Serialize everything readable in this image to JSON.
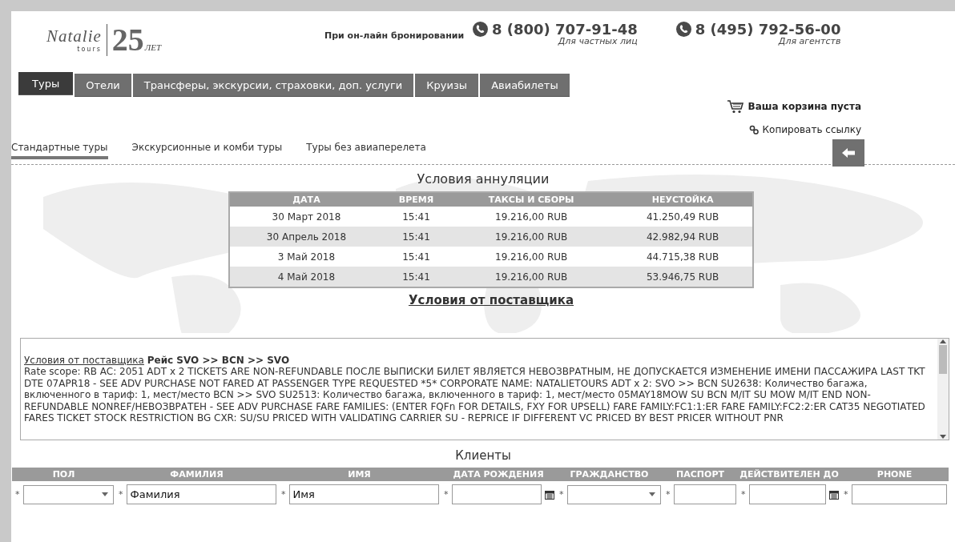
{
  "header": {
    "logo_year": "25",
    "logo_years_word": "ЛЕТ",
    "logo_brand": "Natalie",
    "logo_sub": "tours",
    "booking_label": "При он-лайн бронировании",
    "phones": [
      {
        "number": "8 (800) 707-91-48",
        "note": "Для частных лиц"
      },
      {
        "number": "8 (495) 792-56-00",
        "note": "Для агентств"
      }
    ]
  },
  "nav": [
    {
      "label": "Туры",
      "selected": true
    },
    {
      "label": "Отели",
      "selected": false
    },
    {
      "label": "Трансферы, экскурсии, страховки, доп. услуги",
      "selected": false
    },
    {
      "label": "Круизы",
      "selected": false
    },
    {
      "label": "Авиабилеты",
      "selected": false
    }
  ],
  "cart": "Ваша корзина пуста",
  "copy_link": "Копировать ссылку",
  "subtabs": [
    {
      "label": "Стандартные туры",
      "selected": true
    },
    {
      "label": "Экскурсионные и комби туры",
      "selected": false
    },
    {
      "label": "Туры без авиаперелета",
      "selected": false
    }
  ],
  "cancellation": {
    "title": "Условия аннуляции",
    "columns": [
      "ДАТА",
      "ВРЕМЯ",
      "ТАКСЫ И СБОРЫ",
      "НЕУСТОЙКА"
    ],
    "rows": [
      [
        "30 Март 2018",
        "15:41",
        "19.216,00 RUB",
        "41.250,49 RUB"
      ],
      [
        "30 Апрель 2018",
        "15:41",
        "19.216,00 RUB",
        "42.982,94 RUB"
      ],
      [
        "3 Май 2018",
        "15:41",
        "19.216,00 RUB",
        "44.715,38 RUB"
      ],
      [
        "4 Май 2018",
        "15:41",
        "19.216,00 RUB",
        "53.946,75 RUB"
      ]
    ]
  },
  "supplier_title": "Условия от поставщика",
  "supplier_box": {
    "link": "Условия от поставщика",
    "flight": "Рейс SVO >> BCN >> SVO",
    "text": "Rate scope: RB AC: 2051 ADT x 2 TICKETS ARE NON-REFUNDABLE ПОСЛЕ ВЫПИСКИ БИЛЕТ ЯВЛЯЕТСЯ НЕВОЗВРАТНЫМ, НЕ ДОПУСКАЕТСЯ ИЗМЕНЕНИЕ ИМЕНИ ПАССАЖИРА LAST TKT DTE 07APR18 - SEE ADV PURCHASE NOT FARED AT PASSENGER TYPE REQUESTED *5* CORPORATE NAME: NATALIETOURS ADT x 2: SVO >> BCN SU2638: Количество багажа, включенного в тариф: 1, мест/место BCN >> SVO SU2513: Количество багажа, включенного в тариф: 1, мест/место 05MAY18MOW SU BCN M/IT SU MOW M/IT END NON-REFUNDABLE NONREF/НЕВОЗВРАТЕН - SEE ADV PURCHASE FARE FAMILIES: (ENTER FQFn FOR DETAILS, FXY FOR UPSELL) FARE FAMILY:FC1:1:ER FARE FAMILY:FC2:2:ER CAT35 NEGOTIATED FARES TICKET STOCK RESTRICTION BG CXR: SU/SU PRICED WITH VALIDATING CARRIER SU - REPRICE IF DIFFERENT VC PRICED BY BEST PRICER WITHOUT PNR"
  },
  "clients": {
    "title": "Клиенты",
    "columns": [
      {
        "label": "ПОЛ",
        "kind": "select",
        "required": true
      },
      {
        "label": "ФАМИЛИЯ",
        "kind": "text",
        "required": true,
        "value": "Фамилия"
      },
      {
        "label": "ИМЯ",
        "kind": "text",
        "required": true,
        "value": "Имя"
      },
      {
        "label": "ДАТА РОЖДЕНИЯ",
        "kind": "date",
        "required": true
      },
      {
        "label": "ГРАЖДАНСТВО",
        "kind": "select",
        "required": true
      },
      {
        "label": "ПАСПОРТ",
        "kind": "text",
        "required": true
      },
      {
        "label": "ДЕЙСТВИТЕЛЕН ДО",
        "kind": "date",
        "required": true
      },
      {
        "label": "PHONE",
        "kind": "text",
        "required": true
      }
    ],
    "required_mark": "*"
  }
}
